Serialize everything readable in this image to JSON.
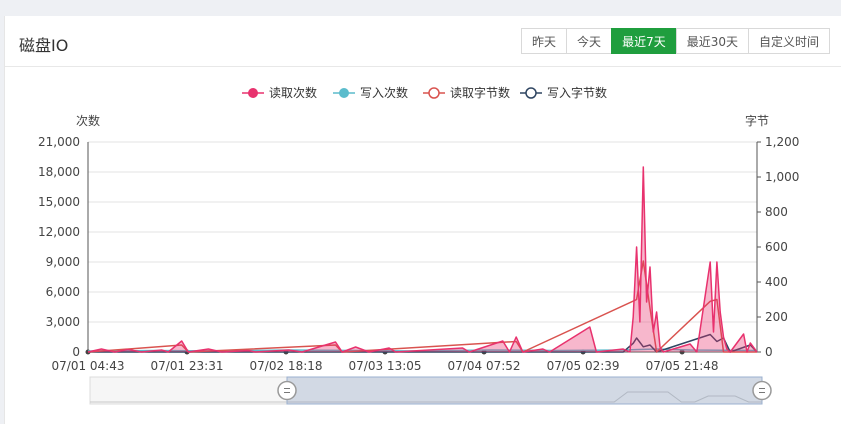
{
  "panel": {
    "title": "磁盘IO",
    "ranges": [
      "昨天",
      "今天",
      "最近7天",
      "最近30天",
      "自定义时间"
    ],
    "active_range": "最近7天"
  },
  "colors": {
    "read_count": "#e8326e",
    "write_count": "#5bbccc",
    "read_bytes": "#d9534f",
    "write_bytes": "#2f4561",
    "active_button": "#1f9e3e"
  },
  "chart_data": {
    "type": "line",
    "title": "",
    "legend_position": "top-center",
    "grid": true,
    "yaxis_left": {
      "label": "次数",
      "ticks": [
        "0",
        "3,000",
        "6,000",
        "9,000",
        "12,000",
        "15,000",
        "18,000",
        "21,000"
      ],
      "range": [
        0,
        21000
      ]
    },
    "yaxis_right": {
      "label": "字节",
      "ticks": [
        "0",
        "200",
        "400",
        "600",
        "800",
        "1,000",
        "1,200"
      ],
      "range": [
        0,
        1200
      ]
    },
    "x_ticks": [
      "07/01 04:43",
      "07/01 23:31",
      "07/02 18:18",
      "07/03 13:05",
      "07/04 07:52",
      "07/05 02:39",
      "07/05 21:48"
    ],
    "series": [
      {
        "name": "读取次数",
        "axis": "left",
        "marker": "filled-circle",
        "color_key": "read_count",
        "points": [
          [
            0,
            0
          ],
          [
            2,
            300
          ],
          [
            4,
            0
          ],
          [
            6,
            250
          ],
          [
            8,
            0
          ],
          [
            11,
            200
          ],
          [
            12,
            0
          ],
          [
            14,
            1100
          ],
          [
            15,
            0
          ],
          [
            18,
            300
          ],
          [
            20,
            0
          ],
          [
            24,
            150
          ],
          [
            25,
            0
          ],
          [
            30,
            200
          ],
          [
            32,
            0
          ],
          [
            37,
            1000
          ],
          [
            38,
            0
          ],
          [
            40,
            500
          ],
          [
            42,
            0
          ],
          [
            45,
            400
          ],
          [
            46,
            0
          ],
          [
            56,
            400
          ],
          [
            57,
            0
          ],
          [
            62,
            1100
          ],
          [
            63,
            0
          ],
          [
            64,
            1500
          ],
          [
            65,
            0
          ],
          [
            68,
            300
          ],
          [
            69,
            0
          ],
          [
            75,
            2500
          ],
          [
            76,
            0
          ],
          [
            80,
            300
          ],
          [
            81,
            0
          ],
          [
            81.5,
            3500
          ],
          [
            82,
            10500
          ],
          [
            82.5,
            3000
          ],
          [
            83,
            18500
          ],
          [
            83.5,
            5000
          ],
          [
            84,
            8500
          ],
          [
            84.5,
            2000
          ],
          [
            85,
            4000
          ],
          [
            85.5,
            500
          ],
          [
            86,
            0
          ],
          [
            90,
            800
          ],
          [
            91,
            0
          ],
          [
            93,
            9000
          ],
          [
            93.5,
            2000
          ],
          [
            94,
            9000
          ],
          [
            94.5,
            4000
          ],
          [
            95,
            1500
          ],
          [
            95.5,
            300
          ],
          [
            96,
            0
          ],
          [
            98,
            1800
          ],
          [
            98.5,
            0
          ],
          [
            99,
            900
          ],
          [
            100,
            0
          ]
        ]
      },
      {
        "name": "写入次数",
        "axis": "left",
        "marker": "filled-circle",
        "color_key": "write_count",
        "points": [
          [
            0,
            100
          ],
          [
            10,
            150
          ],
          [
            20,
            100
          ],
          [
            30,
            200
          ],
          [
            40,
            150
          ],
          [
            50,
            100
          ],
          [
            60,
            200
          ],
          [
            70,
            150
          ],
          [
            80,
            200
          ],
          [
            85,
            300
          ],
          [
            90,
            200
          ],
          [
            100,
            150
          ]
        ]
      },
      {
        "name": "读取字节数",
        "axis": "right",
        "marker": "hollow-circle",
        "color_key": "read_bytes",
        "points": [
          [
            0,
            0
          ],
          [
            14,
            40
          ],
          [
            15,
            0
          ],
          [
            37,
            40
          ],
          [
            38,
            0
          ],
          [
            64,
            60
          ],
          [
            65,
            0
          ],
          [
            82,
            300
          ],
          [
            83,
            520
          ],
          [
            84,
            250
          ],
          [
            85,
            0
          ],
          [
            93,
            290
          ],
          [
            94,
            300
          ],
          [
            95,
            0
          ],
          [
            100,
            0
          ]
        ]
      },
      {
        "name": "写入字节数",
        "axis": "right",
        "marker": "hollow-circle",
        "color_key": "write_bytes",
        "points": [
          [
            0,
            0
          ],
          [
            80,
            0
          ],
          [
            81.5,
            50
          ],
          [
            82,
            80
          ],
          [
            83,
            30
          ],
          [
            84,
            40
          ],
          [
            85,
            0
          ],
          [
            93,
            100
          ],
          [
            94,
            60
          ],
          [
            95,
            80
          ],
          [
            96,
            0
          ],
          [
            99,
            40
          ],
          [
            100,
            0
          ]
        ]
      }
    ]
  }
}
